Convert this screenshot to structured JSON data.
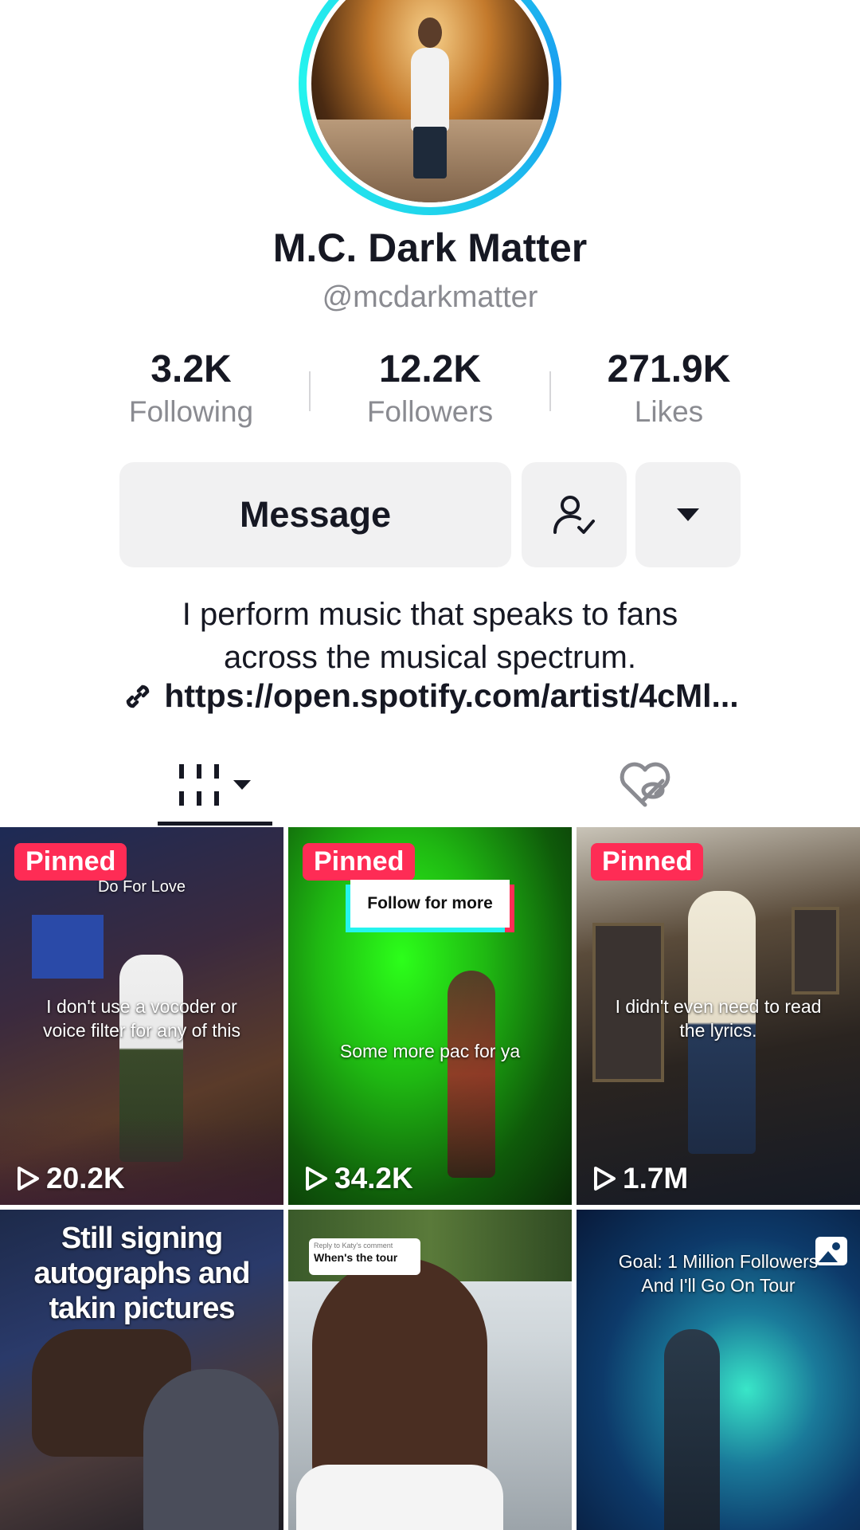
{
  "profile": {
    "name": "M.C. Dark Matter",
    "handle": "@mcdarkmatter",
    "bio_line1": "I perform music that speaks to fans",
    "bio_line2": "across the musical spectrum.",
    "link": "https://open.spotify.com/artist/4cMl..."
  },
  "stats": [
    {
      "value": "3.2K",
      "label": "Following"
    },
    {
      "value": "12.2K",
      "label": "Followers"
    },
    {
      "value": "271.9K",
      "label": "Likes"
    }
  ],
  "actions": {
    "message_label": "Message",
    "following_icon": "user-check-icon",
    "more_icon": "caret-down-icon"
  },
  "tabs": {
    "videos_icon": "grid-icon",
    "liked_icon": "heart-hidden-icon"
  },
  "videos": [
    {
      "pinned": "Pinned",
      "views": "20.2K",
      "top_text": "Do For Love",
      "caption_1": "I don't use a vocoder or",
      "caption_2": "voice filter for any of this"
    },
    {
      "pinned": "Pinned",
      "views": "34.2K",
      "overlay": "Follow for more",
      "caption_1": "Some more pac for ya"
    },
    {
      "pinned": "Pinned",
      "views": "1.7M",
      "caption_1": "I didn't even need to read",
      "caption_2": "the lyrics."
    },
    {
      "caption_1": "Still signing",
      "caption_2": "autographs and",
      "caption_3": "takin pictures"
    },
    {
      "reply_header": "Reply to Katy's comment",
      "reply_text": "When's the tour"
    },
    {
      "caption_1": "Goal: 1 Million Followers",
      "caption_2": "And I'll Go On Tour",
      "icon": "photo-icon"
    }
  ],
  "colors": {
    "accent": "#fe2c55",
    "ring": "#20d5ec",
    "muted": "#8a8b91",
    "button_bg": "#f1f1f2"
  }
}
